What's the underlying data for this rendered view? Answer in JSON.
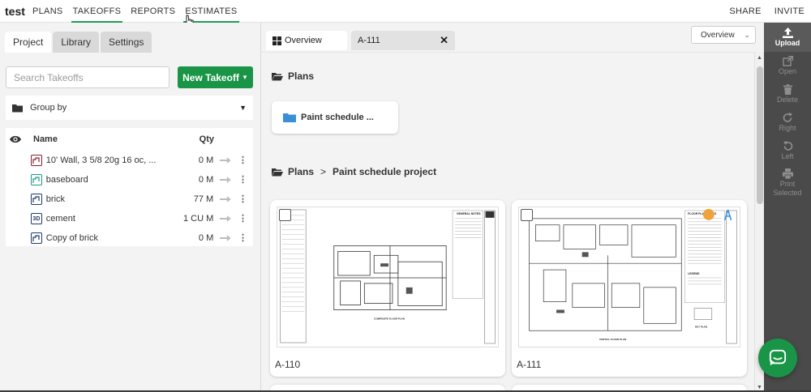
{
  "topnav": {
    "app_title": "test",
    "items": [
      {
        "label": "PLANS",
        "active": false
      },
      {
        "label": "TAKEOFFS",
        "active": true
      },
      {
        "label": "REPORTS",
        "active": false
      },
      {
        "label": "ESTIMATES",
        "active": true
      }
    ],
    "share_label": "SHARE",
    "invite_label": "INVITE",
    "accent_color": "#1f9d55"
  },
  "left_panel": {
    "tabs": [
      {
        "label": "Project",
        "active": true
      },
      {
        "label": "Library",
        "active": false
      },
      {
        "label": "Settings",
        "active": false
      }
    ],
    "search_placeholder": "Search Takeoffs",
    "new_takeoff_label": "New Takeoff",
    "group_by_label": "Group by",
    "list": {
      "col_name": "Name",
      "col_qty": "Qty",
      "rows": [
        {
          "name": "10' Wall, 3 5/8 20g 16 oc, ...",
          "qty": "0 M",
          "icon": "linear-icon",
          "icon_color": "#8b1e2b"
        },
        {
          "name": "baseboard",
          "qty": "0 M",
          "icon": "linear-icon",
          "icon_color": "#1a9a8a"
        },
        {
          "name": "brick",
          "qty": "77 M",
          "icon": "linear-icon",
          "icon_color": "#1f3a6e"
        },
        {
          "name": "cement",
          "qty": "1 CU M",
          "icon": "3d-icon",
          "icon_label": "3D",
          "icon_color": "#1f3a6e"
        },
        {
          "name": "Copy of brick",
          "qty": "0 M",
          "icon": "linear-icon",
          "icon_color": "#1f3a6e"
        }
      ]
    }
  },
  "center": {
    "tabs": [
      {
        "label": "Overview",
        "active": true
      },
      {
        "label": "A-111",
        "active": false
      }
    ],
    "view_select_value": "Overview",
    "plans_heading": "Plans",
    "folder_card_label": "Paint schedule ...",
    "breadcrumb": {
      "root": "Plans",
      "sep": ">",
      "current": "Paint schedule project"
    },
    "sheets": [
      {
        "label": "A-110",
        "title_text": "COMPOSITE FLOOR PLAN",
        "notes_header": "GENERAL NOTES"
      },
      {
        "label": "A-111",
        "title_text": "PARTIAL FLOOR PLAN",
        "notes_header": "FLOOR PLAN NOTES",
        "legend_header": "LEGEND",
        "key_plan_label": "KEY PLAN"
      }
    ]
  },
  "right_toolbar": {
    "buttons": [
      {
        "label": "Upload",
        "icon": "upload-icon",
        "enabled": true
      },
      {
        "label": "Open",
        "icon": "open-icon",
        "enabled": false
      },
      {
        "label": "Delete",
        "icon": "trash-icon",
        "enabled": false
      },
      {
        "label": "Right",
        "icon": "rotate-right-icon",
        "enabled": false
      },
      {
        "label": "Left",
        "icon": "rotate-left-icon",
        "enabled": false
      },
      {
        "label": "Print Selected",
        "icon": "print-icon",
        "enabled": false
      }
    ]
  },
  "chat": {
    "icon": "chat-icon",
    "color": "#1a9447"
  }
}
